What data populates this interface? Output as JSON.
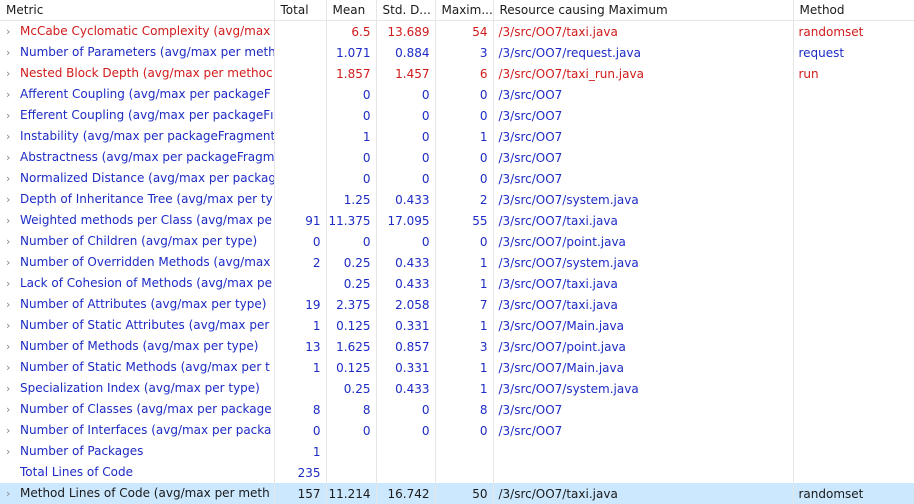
{
  "headers": {
    "metric": "Metric",
    "total": "Total",
    "mean": "Mean",
    "std": "Std. D...",
    "max": "Maxim...",
    "resource": "Resource causing Maximum",
    "method": "Method"
  },
  "rows": [
    {
      "metric": "McCabe Cyclomatic Complexity (avg/max",
      "total": "",
      "mean": "6.5",
      "std": "13.689",
      "max": "54",
      "resource": "/3/src/OO7/taxi.java",
      "method": "randomset",
      "color": "red",
      "expandable": true
    },
    {
      "metric": "Number of Parameters (avg/max per meth",
      "total": "",
      "mean": "1.071",
      "std": "0.884",
      "max": "3",
      "resource": "/3/src/OO7/request.java",
      "method": "request",
      "color": "blue",
      "expandable": true
    },
    {
      "metric": "Nested Block Depth (avg/max per methoc",
      "total": "",
      "mean": "1.857",
      "std": "1.457",
      "max": "6",
      "resource": "/3/src/OO7/taxi_run.java",
      "method": "run",
      "color": "red",
      "expandable": true
    },
    {
      "metric": "Afferent Coupling (avg/max per packageF",
      "total": "",
      "mean": "0",
      "std": "0",
      "max": "0",
      "resource": "/3/src/OO7",
      "method": "",
      "color": "blue",
      "expandable": true
    },
    {
      "metric": "Efferent Coupling (avg/max per packageFı",
      "total": "",
      "mean": "0",
      "std": "0",
      "max": "0",
      "resource": "/3/src/OO7",
      "method": "",
      "color": "blue",
      "expandable": true
    },
    {
      "metric": "Instability (avg/max per packageFragment",
      "total": "",
      "mean": "1",
      "std": "0",
      "max": "1",
      "resource": "/3/src/OO7",
      "method": "",
      "color": "blue",
      "expandable": true
    },
    {
      "metric": "Abstractness (avg/max per packageFragm",
      "total": "",
      "mean": "0",
      "std": "0",
      "max": "0",
      "resource": "/3/src/OO7",
      "method": "",
      "color": "blue",
      "expandable": true
    },
    {
      "metric": "Normalized Distance (avg/max per packag",
      "total": "",
      "mean": "0",
      "std": "0",
      "max": "0",
      "resource": "/3/src/OO7",
      "method": "",
      "color": "blue",
      "expandable": true
    },
    {
      "metric": "Depth of Inheritance Tree (avg/max per ty",
      "total": "",
      "mean": "1.25",
      "std": "0.433",
      "max": "2",
      "resource": "/3/src/OO7/system.java",
      "method": "",
      "color": "blue",
      "expandable": true
    },
    {
      "metric": "Weighted methods per Class (avg/max pe",
      "total": "91",
      "mean": "11.375",
      "std": "17.095",
      "max": "55",
      "resource": "/3/src/OO7/taxi.java",
      "method": "",
      "color": "blue",
      "expandable": true
    },
    {
      "metric": "Number of Children (avg/max per type)",
      "total": "0",
      "mean": "0",
      "std": "0",
      "max": "0",
      "resource": "/3/src/OO7/point.java",
      "method": "",
      "color": "blue",
      "expandable": true
    },
    {
      "metric": "Number of Overridden Methods (avg/max",
      "total": "2",
      "mean": "0.25",
      "std": "0.433",
      "max": "1",
      "resource": "/3/src/OO7/system.java",
      "method": "",
      "color": "blue",
      "expandable": true
    },
    {
      "metric": "Lack of Cohesion of Methods (avg/max pe",
      "total": "",
      "mean": "0.25",
      "std": "0.433",
      "max": "1",
      "resource": "/3/src/OO7/taxi.java",
      "method": "",
      "color": "blue",
      "expandable": true
    },
    {
      "metric": "Number of Attributes (avg/max per type)",
      "total": "19",
      "mean": "2.375",
      "std": "2.058",
      "max": "7",
      "resource": "/3/src/OO7/taxi.java",
      "method": "",
      "color": "blue",
      "expandable": true
    },
    {
      "metric": "Number of Static Attributes (avg/max per",
      "total": "1",
      "mean": "0.125",
      "std": "0.331",
      "max": "1",
      "resource": "/3/src/OO7/Main.java",
      "method": "",
      "color": "blue",
      "expandable": true
    },
    {
      "metric": "Number of Methods (avg/max per type)",
      "total": "13",
      "mean": "1.625",
      "std": "0.857",
      "max": "3",
      "resource": "/3/src/OO7/point.java",
      "method": "",
      "color": "blue",
      "expandable": true
    },
    {
      "metric": "Number of Static Methods (avg/max per t",
      "total": "1",
      "mean": "0.125",
      "std": "0.331",
      "max": "1",
      "resource": "/3/src/OO7/Main.java",
      "method": "",
      "color": "blue",
      "expandable": true
    },
    {
      "metric": "Specialization Index (avg/max per type)",
      "total": "",
      "mean": "0.25",
      "std": "0.433",
      "max": "1",
      "resource": "/3/src/OO7/system.java",
      "method": "",
      "color": "blue",
      "expandable": true
    },
    {
      "metric": "Number of Classes (avg/max per package",
      "total": "8",
      "mean": "8",
      "std": "0",
      "max": "8",
      "resource": "/3/src/OO7",
      "method": "",
      "color": "blue",
      "expandable": true
    },
    {
      "metric": "Number of Interfaces (avg/max per packa",
      "total": "0",
      "mean": "0",
      "std": "0",
      "max": "0",
      "resource": "/3/src/OO7",
      "method": "",
      "color": "blue",
      "expandable": true
    },
    {
      "metric": "Number of Packages",
      "total": "1",
      "mean": "",
      "std": "",
      "max": "",
      "resource": "",
      "method": "",
      "color": "blue",
      "expandable": true
    },
    {
      "metric": "Total Lines of Code",
      "total": "235",
      "mean": "",
      "std": "",
      "max": "",
      "resource": "",
      "method": "",
      "color": "blue",
      "expandable": false
    },
    {
      "metric": "Method Lines of Code (avg/max per meth",
      "total": "157",
      "mean": "11.214",
      "std": "16.742",
      "max": "50",
      "resource": "/3/src/OO7/taxi.java",
      "method": "randomset",
      "color": "black",
      "expandable": true,
      "selected": true
    }
  ],
  "icons": {
    "expand": "chevron-right-icon"
  },
  "colors": {
    "link_blue": "#1d2bc4",
    "warning_red": "#d11a1a",
    "selection": "#cce8ff"
  }
}
